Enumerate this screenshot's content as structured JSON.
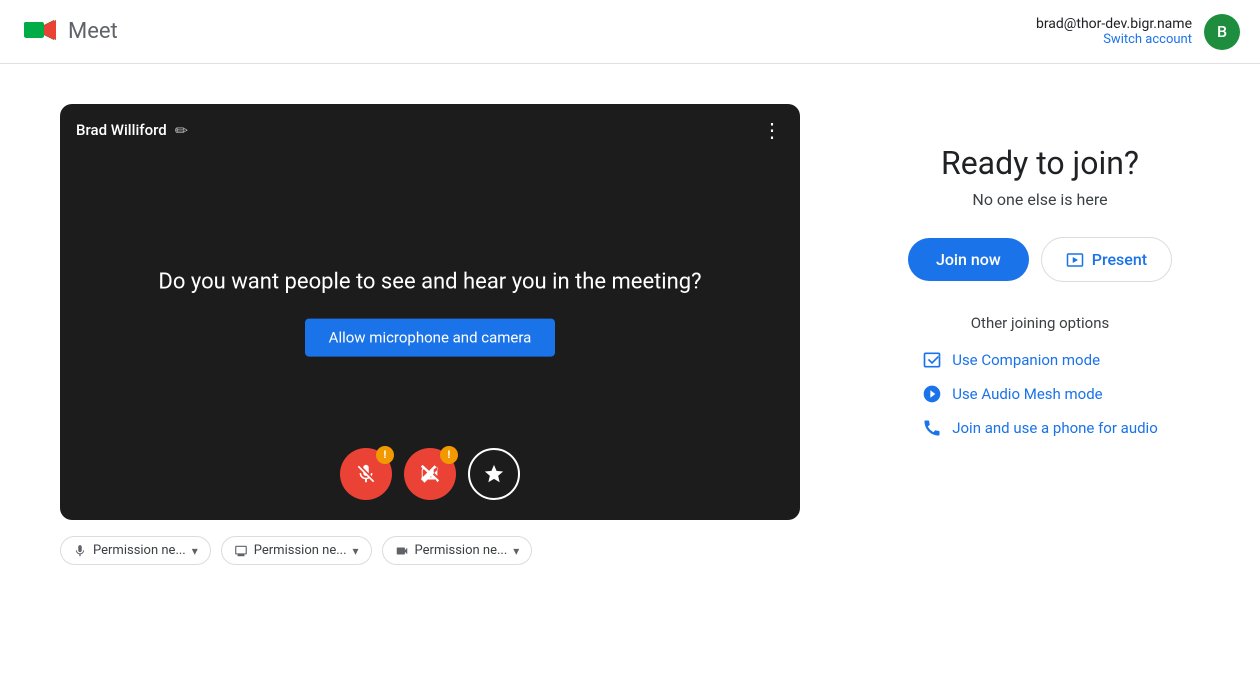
{
  "header": {
    "app_name": "Meet",
    "user_email": "brad@thor-dev.bigr.name",
    "switch_account_label": "Switch account",
    "avatar_letter": "B",
    "avatar_color": "#1e8e3e"
  },
  "video": {
    "user_name": "Brad Williford",
    "question_text": "Do you want people to see and hear you in the meeting?",
    "allow_btn_label": "Allow microphone and camera"
  },
  "permissions": {
    "mic_label": "Permission ne...",
    "display_label": "Permission ne...",
    "camera_label": "Permission ne..."
  },
  "join_panel": {
    "ready_title": "Ready to join?",
    "no_one_text": "No one else is here",
    "join_now_label": "Join now",
    "present_label": "Present",
    "other_options_title": "Other joining options",
    "companion_mode_label": "Use Companion mode",
    "audio_mesh_label": "Use Audio Mesh mode",
    "phone_audio_label": "Join and use a phone for audio"
  },
  "icons": {
    "edit": "✏",
    "more_vert": "⋮",
    "mic_off": "🚫",
    "camera_off": "🚫",
    "effects": "✦",
    "present_icon": "⊞",
    "companion_icon": "⊡",
    "audio_mesh_icon": "⊙",
    "phone_icon": "☎"
  }
}
